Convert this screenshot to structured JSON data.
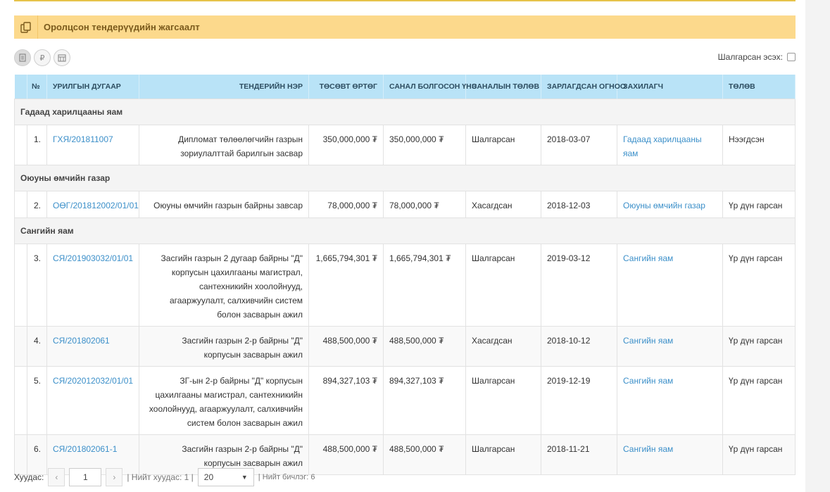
{
  "panel": {
    "title": "Оролцсон тендерүүдийн жагсаалт"
  },
  "toolbar": {
    "icons": [
      "document-icon",
      "ruble-icon",
      "calendar-icon"
    ]
  },
  "filter": {
    "label": "Шалгарсан эсэх:"
  },
  "table": {
    "headers": [
      "№",
      "УРИЛГЫН ДУГААР",
      "ТЕНДЕРИЙН НЭР",
      "ТӨСӨВТ ӨРТӨГ",
      "САНАЛ БОЛГОСОН ҮНЭ",
      "САНАЛЫН ТӨЛӨВ",
      "ЗАРЛАГДСАН ОГНОО",
      "ЗАХИЛАГЧ",
      "ТӨЛӨВ"
    ],
    "groups": [
      {
        "name": "Гадаад харилцааны яам",
        "rows": [
          {
            "no": "1.",
            "code": "ГХЯ/201811007",
            "name": "Дипломат төлөөлөгчийн газрын зориулалттай барилгын засвар",
            "budget": "350,000,000 ₮",
            "offer": "350,000,000 ₮",
            "offer_status": "Шалгарсан",
            "date": "2018-03-07",
            "customer": "Гадаад харилцааны яам",
            "status": "Нээгдсэн"
          }
        ]
      },
      {
        "name": "Оюуны өмчийн газар",
        "rows": [
          {
            "no": "2.",
            "code": "ОӨГ/201812002/01/01",
            "name": "Оюуны өмчийн газрын байрны завсар",
            "budget": "78,000,000 ₮",
            "offer": "78,000,000 ₮",
            "offer_status": "Хасагдсан",
            "date": "2018-12-03",
            "customer": "Оюуны өмчийн газар",
            "status": "Үр дүн гарсан"
          }
        ]
      },
      {
        "name": "Сангийн яам",
        "rows": [
          {
            "no": "3.",
            "code": "СЯ/201903032/01/01",
            "name": "Засгийн газрын 2 дугаар байрны \"Д\" корпусын цахилгааны магистрал, сантехникийн хоолойнууд, агааржуулалт, салхивчийн систем болон засварын ажил",
            "budget": "1,665,794,301 ₮",
            "offer": "1,665,794,301 ₮",
            "offer_status": "Шалгарсан",
            "date": "2019-03-12",
            "customer": "Сангийн яам",
            "status": "Үр дүн гарсан"
          },
          {
            "no": "4.",
            "code": "СЯ/201802061",
            "name": "Засгийн газрын 2-р байрны \"Д\" корпусын засварын ажил",
            "budget": "488,500,000 ₮",
            "offer": "488,500,000 ₮",
            "offer_status": "Хасагдсан",
            "date": "2018-10-12",
            "customer": "Сангийн яам",
            "status": "Үр дүн гарсан"
          },
          {
            "no": "5.",
            "code": "СЯ/202012032/01/01",
            "name": "ЗГ-ын 2-р байрны \"Д\" корпусын цахилгааны магистрал, сантехникийн хоолойнууд, агааржуулалт, салхивчийн систем болон засварын ажил",
            "budget": "894,327,103 ₮",
            "offer": "894,327,103 ₮",
            "offer_status": "Шалгарсан",
            "date": "2019-12-19",
            "customer": "Сангийн яам",
            "status": "Үр дүн гарсан"
          },
          {
            "no": "6.",
            "code": "СЯ/201802061-1",
            "name": "Засгийн газрын 2-р байрны \"Д\" корпусын засварын ажил",
            "budget": "488,500,000 ₮",
            "offer": "488,500,000 ₮",
            "offer_status": "Шалгарсан",
            "date": "2018-11-21",
            "customer": "Сангийн яам",
            "status": "Үр дүн гарсан"
          }
        ]
      }
    ]
  },
  "pager": {
    "label": "Хуудас:",
    "page": "1",
    "total_pages_label": "| Нийт хуудас: 1 |",
    "page_size": "20",
    "total_records_label": "| Нийт бичлэг: 6"
  },
  "colors": {
    "header_bg": "#fcd98c",
    "table_header_bg": "#b9e3f7",
    "link": "#3b8fc9"
  }
}
